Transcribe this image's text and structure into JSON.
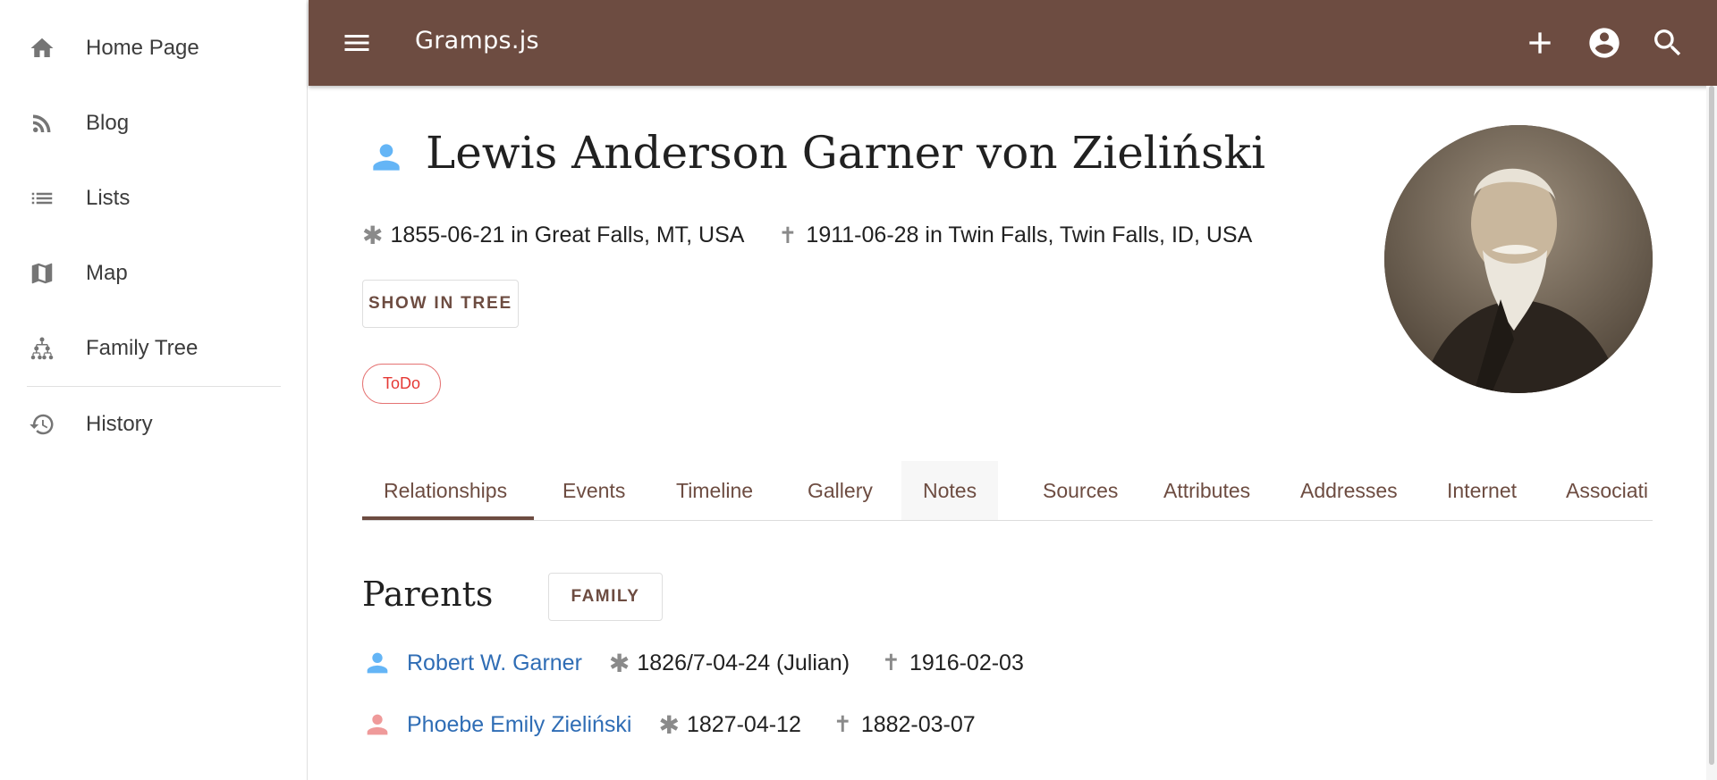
{
  "app": {
    "title": "Gramps.js"
  },
  "sidebar": {
    "items": [
      {
        "label": "Home Page",
        "icon": "home-icon"
      },
      {
        "label": "Blog",
        "icon": "rss-feed-icon"
      },
      {
        "label": "Lists",
        "icon": "list-icon"
      },
      {
        "label": "Map",
        "icon": "map-icon"
      },
      {
        "label": "Family Tree",
        "icon": "family-tree-icon"
      },
      {
        "label": "History",
        "icon": "history-icon"
      }
    ]
  },
  "topbar": {
    "actions": [
      "add-icon",
      "account-icon",
      "search-icon"
    ]
  },
  "person": {
    "name": "Lewis Anderson Garner von Zieliński",
    "birth": "1855-06-21 in Great Falls, MT, USA",
    "death": "1911-06-28 in Twin Falls, Twin Falls, ID, USA",
    "birth_symbol": "✱",
    "death_symbol": "✝",
    "show_in_tree_label": "SHOW IN TREE",
    "tag": "ToDo"
  },
  "tabs": [
    {
      "label": "Relationships",
      "active": true
    },
    {
      "label": "Events"
    },
    {
      "label": "Timeline"
    },
    {
      "label": "Gallery"
    },
    {
      "label": "Notes"
    },
    {
      "label": "Sources"
    },
    {
      "label": "Attributes"
    },
    {
      "label": "Addresses"
    },
    {
      "label": "Internet"
    },
    {
      "label": "Associati"
    }
  ],
  "parents": {
    "title": "Parents",
    "family_button": "FAMILY",
    "list": [
      {
        "name": "Robert W. Garner",
        "birth": "1826/7-04-24 (Julian)",
        "death": "1916-02-03",
        "gender": "male"
      },
      {
        "name": "Phoebe Emily Zieliński",
        "birth": "1827-04-12",
        "death": "1882-03-07",
        "gender": "female"
      }
    ]
  },
  "colors": {
    "primary": "#6d4c41",
    "male": "#64b5f6",
    "female": "#ef9a9a",
    "link": "#2f6db5",
    "tag": "#e53935"
  }
}
